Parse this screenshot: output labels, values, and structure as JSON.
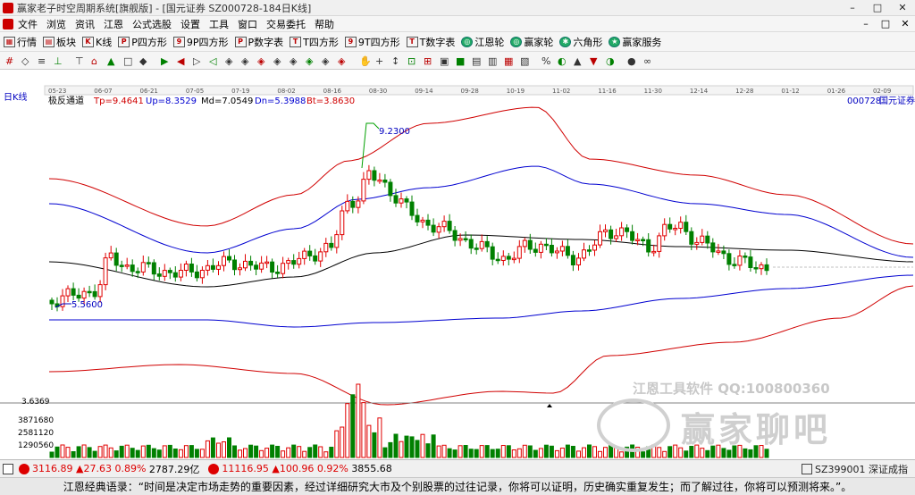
{
  "window": {
    "title": "赢家老子时空周期系统[旗舰版] - [国元证券  SZ000728-184日K线]",
    "minimize": "–",
    "maximize": "□",
    "close": "✕"
  },
  "menu": {
    "items": [
      "文件",
      "浏览",
      "资讯",
      "江恩",
      "公式选股",
      "设置",
      "工具",
      "窗口",
      "交易委托",
      "帮助"
    ],
    "right": [
      "–",
      "□",
      "✕"
    ]
  },
  "toolbar1": {
    "items": [
      {
        "label": "行情",
        "icon": "grid-icon"
      },
      {
        "label": "板块",
        "icon": "blocks-icon"
      },
      {
        "label": "K线",
        "icon": "kline-icon"
      },
      {
        "label": "P四方形",
        "icon": "p-square-icon"
      },
      {
        "label": "9P四方形",
        "icon": "9p-square-icon"
      },
      {
        "label": "P数字表",
        "icon": "p-table-icon"
      },
      {
        "label": "T四方形",
        "icon": "t-square-icon"
      },
      {
        "label": "9T四方形",
        "icon": "9t-square-icon"
      },
      {
        "label": "T数字表",
        "icon": "t-table-icon"
      },
      {
        "label": "江恩轮",
        "icon": "gann-wheel-icon"
      },
      {
        "label": "赢家轮",
        "icon": "winner-wheel-icon"
      },
      {
        "label": "六角形",
        "icon": "hexagon-icon"
      },
      {
        "label": "赢家服务",
        "icon": "service-icon"
      }
    ]
  },
  "chart": {
    "period_label": "日K线",
    "dates": [
      "05-23",
      "06-07",
      "06-21",
      "07-05",
      "07-19",
      "08-02",
      "08-16",
      "08-30",
      "09-14",
      "09-28",
      "10-19",
      "11-02",
      "11-16",
      "11-30",
      "12-14",
      "12-28",
      "01-12",
      "01-26",
      "02-09"
    ],
    "indicator": {
      "name": "极反通道",
      "tp": "Tp=9.4641",
      "up": "Up=8.3529",
      "md": "Md=7.0549",
      "dn": "Dn=5.3988",
      "bt": "Bt=3.8630"
    },
    "stock_code": "000728",
    "stock_name": "国元证券",
    "high_label": "9.2300",
    "low_label": "5.5600",
    "volume_axis": [
      "3.6369",
      "3871680",
      "2581120",
      "1290560"
    ],
    "colors": {
      "up": "#e00000",
      "down": "#008000",
      "upper_band": "#d00000",
      "mid_band": "#0000d0",
      "center": "#000000"
    }
  },
  "watermark": {
    "text1": "江恩工具软件  QQ:100800360",
    "text2": "赢家聊吧"
  },
  "status": {
    "sh_index": "3116.89",
    "sh_change": "▲27.63",
    "sh_pct": "0.89%",
    "sh_amount": "2787.29亿",
    "sz_index": "11116.95",
    "sz_change": "▲100.96",
    "sz_pct": "0.92%",
    "sz_amount": "3855.68",
    "right": "SZ399001 深证成指"
  },
  "quote": "江恩经典语录：“时间是决定市场走势的重要因素，经过详细研究大市及个别股票的过往记录，你将可以证明，历史确实重复发生；而了解过往，你将可以预测将来。”。"
}
